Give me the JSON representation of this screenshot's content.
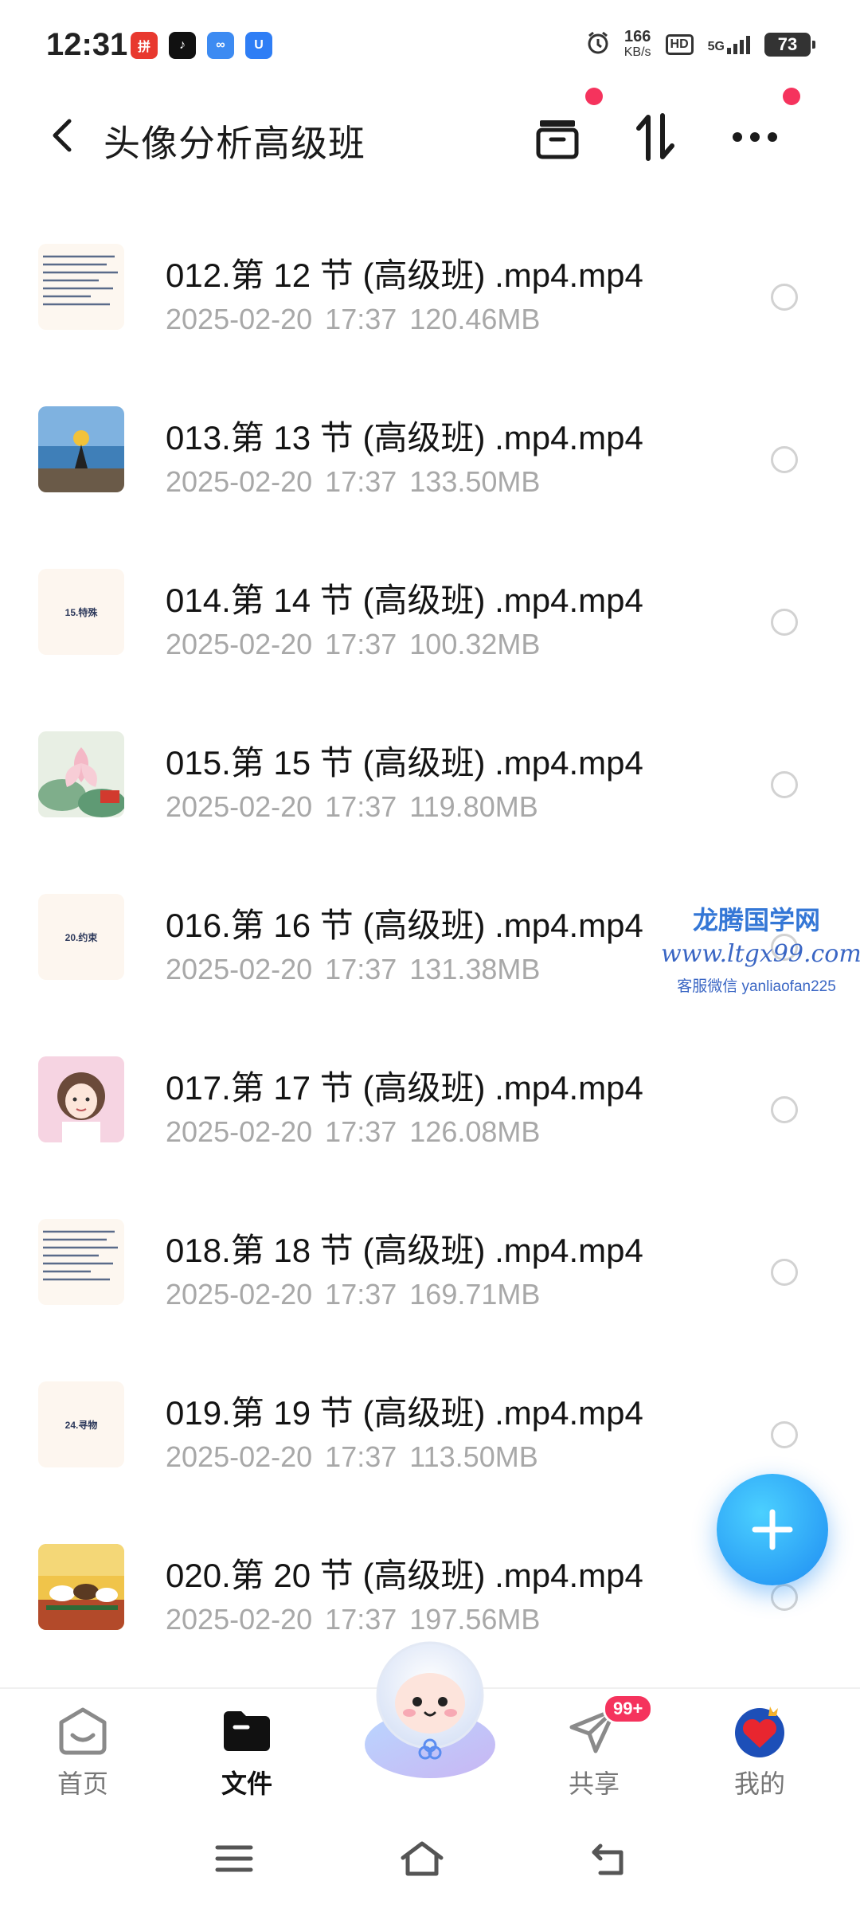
{
  "status_bar": {
    "time": "12:31",
    "apps": [
      {
        "name": "pinduoduo-app-icon",
        "color": "#e8392f",
        "glyph": "拼"
      },
      {
        "name": "tiktok-app-icon",
        "color": "#111111",
        "glyph": "♪"
      },
      {
        "name": "baidu-netdisk-app-icon",
        "color": "#3d8bf2",
        "glyph": "∞"
      },
      {
        "name": "blue-app-icon",
        "color": "#2f7ef5",
        "glyph": "U"
      }
    ],
    "net_speed": "166",
    "net_speed_unit": "KB/s",
    "hd": "HD",
    "network": "5G",
    "battery": "73"
  },
  "header": {
    "title": "头像分析高级班"
  },
  "files": [
    {
      "name": "012.第 12 节 (高级班) .mp4.mp4",
      "date": "2025-02-20",
      "time": "17:37",
      "size": "120.46MB",
      "thumb": "text"
    },
    {
      "name": "013.第 13 节 (高级班) .mp4.mp4",
      "date": "2025-02-20",
      "time": "17:37",
      "size": "133.50MB",
      "thumb": "photo-sea"
    },
    {
      "name": "014.第 14 节 (高级班) .mp4.mp4",
      "date": "2025-02-20",
      "time": "17:37",
      "size": "100.32MB",
      "thumb": "label",
      "thumb_text": "15.特殊"
    },
    {
      "name": "015.第 15 节 (高级班) .mp4.mp4",
      "date": "2025-02-20",
      "time": "17:37",
      "size": "119.80MB",
      "thumb": "photo-lotus"
    },
    {
      "name": "016.第 16 节 (高级班) .mp4.mp4",
      "date": "2025-02-20",
      "time": "17:37",
      "size": "131.38MB",
      "thumb": "label",
      "thumb_text": "20.约束"
    },
    {
      "name": "017.第 17 节 (高级班) .mp4.mp4",
      "date": "2025-02-20",
      "time": "17:37",
      "size": "126.08MB",
      "thumb": "photo-girl"
    },
    {
      "name": "018.第 18 节 (高级班) .mp4.mp4",
      "date": "2025-02-20",
      "time": "17:37",
      "size": "169.71MB",
      "thumb": "text"
    },
    {
      "name": "019.第 19 节 (高级班) .mp4.mp4",
      "date": "2025-02-20",
      "time": "17:37",
      "size": "113.50MB",
      "thumb": "label",
      "thumb_text": "24.寻物"
    },
    {
      "name": "020.第 20 节 (高级班) .mp4.mp4",
      "date": "2025-02-20",
      "time": "17:37",
      "size": "197.56MB",
      "thumb": "photo-horses"
    }
  ],
  "watermark": {
    "line1": "龙腾国学网",
    "line2": "www.ltgx99.com",
    "line3": "客服微信 yanliaofan225"
  },
  "bottom_nav": [
    {
      "key": "home",
      "label": "首页",
      "active": false
    },
    {
      "key": "files",
      "label": "文件",
      "active": true
    },
    {
      "key": "share",
      "label": "共享",
      "active": false,
      "badge": "99+"
    },
    {
      "key": "mine",
      "label": "我的",
      "active": false
    }
  ],
  "colors": {
    "accent": "#1e8cf2",
    "red_dot": "#f5335d",
    "meta_text": "#a8a8a8"
  }
}
